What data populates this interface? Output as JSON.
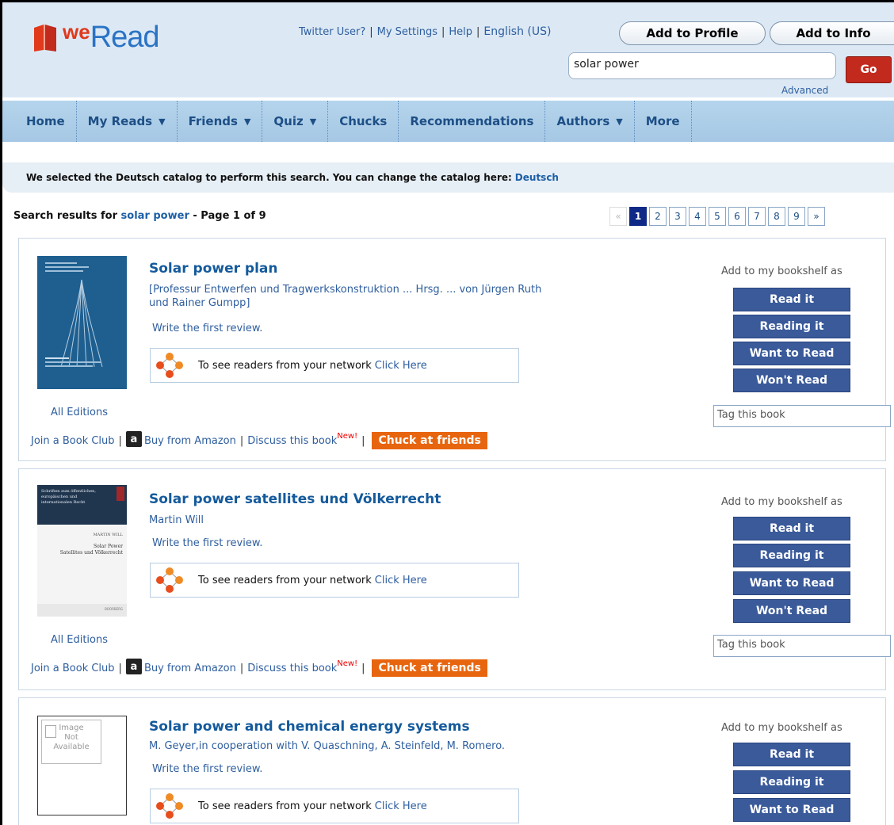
{
  "header": {
    "logo_we": "we",
    "logo_read": "Read",
    "links": [
      "Twitter User?",
      "My Settings",
      "Help",
      "English (US)"
    ],
    "add_profile": "Add to Profile",
    "add_info": "Add to Info",
    "search_value": "solar power",
    "go": "Go",
    "advanced": "Advanced"
  },
  "nav": {
    "items": [
      "Home",
      "My Reads",
      "Friends",
      "Quiz",
      "Chucks",
      "Recommendations",
      "Authors",
      "More"
    ]
  },
  "notice": {
    "text": "We selected the Deutsch catalog to perform this search. You can change the catalog here:",
    "link": "Deutsch"
  },
  "results": {
    "prefix": "Search results for",
    "query": "solar power",
    "suffix": "- Page 1 of 9",
    "pages": [
      "«",
      "1",
      "2",
      "3",
      "4",
      "5",
      "6",
      "7",
      "8",
      "9",
      "»"
    ],
    "current_page": "1"
  },
  "common": {
    "all_editions": "All Editions",
    "write_review": "Write the first review.",
    "network_text": "To see readers from your network",
    "click_here": "Click Here",
    "join_club": "Join a Book Club",
    "buy_amazon": "Buy from Amazon",
    "discuss": "Discuss this book",
    "new": "New!",
    "chuck": "Chuck at friends",
    "shelf_label": "Add to my bookshelf as",
    "shelf_buttons": [
      "Read it",
      "Reading it",
      "Want to Read",
      "Won't Read"
    ],
    "tag_placeholder": "Tag this book",
    "amazon_glyph": "a"
  },
  "books": [
    {
      "title": "Solar power plan",
      "authors": "[Professur Entwerfen und Tragwerkskonstruktion ... Hrsg. ... von Jürgen Ruth und Rainer Gumpp]"
    },
    {
      "title": "Solar power satellites und Völkerrecht",
      "authors": "Martin Will",
      "cover_text": [
        "Schriften zum öffentlichen,",
        "europäischen und",
        "internationalen Recht",
        "MARTIN WILL",
        "Solar Power",
        "Satellites und Völkerrecht",
        "BOORBERG"
      ]
    },
    {
      "title": "Solar power and chemical energy systems",
      "authors": "M. Geyer,in cooperation with V. Quaschning, A. Steinfeld, M. Romero.",
      "no_image": [
        "Image",
        "Not",
        "Available"
      ]
    }
  ]
}
